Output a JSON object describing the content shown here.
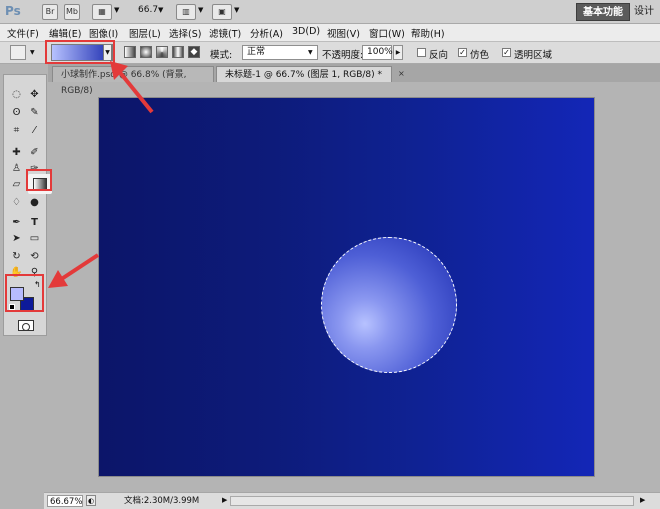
{
  "app": {
    "logo": "Ps",
    "bar_icons": [
      "Br",
      "Mb"
    ],
    "zoom_value": "66.7",
    "workspace_active": "基本功能",
    "workspace_other": "设计"
  },
  "menu": [
    "文件(F)",
    "编辑(E)",
    "图像(I)",
    "图层(L)",
    "选择(S)",
    "滤镜(T)",
    "分析(A)",
    "3D(D)",
    "视图(V)",
    "窗口(W)",
    "帮助(H)"
  ],
  "options": {
    "mode_label": "模式:",
    "mode_value": "正常",
    "opacity_label": "不透明度:",
    "opacity_value": "100%",
    "reverse_label": "反向",
    "dither_label": "仿色",
    "transparency_label": "透明区域",
    "reverse_checked": false,
    "dither_checked": true,
    "transparency_checked": true
  },
  "tabs": [
    {
      "label": "小球制作.psd @ 66.8% (背景, RGB/8)"
    },
    {
      "label": "未标题-1 @ 66.7% (图层 1, RGB/8) *"
    }
  ],
  "status": {
    "zoom": "66.67%",
    "doc_info": "文档:2.30M/3.99M"
  },
  "colors": {
    "foreground": "#b7bbff",
    "background": "#0d1a99",
    "gradient_from": "#b7c2ff",
    "gradient_to": "#1e2eb0",
    "annotation": "#e33a3a"
  }
}
